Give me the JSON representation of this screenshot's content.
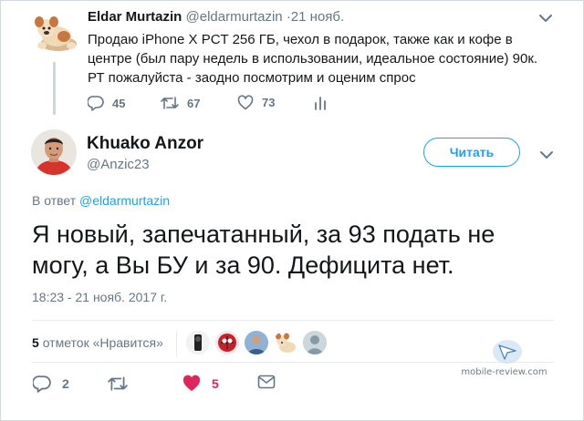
{
  "parent_tweet": {
    "name": "Eldar Murtazin",
    "handle": "@eldarmurtazin",
    "time": "·21 нояб.",
    "text": "Продаю iPhone X PCT 256 ГБ, чехол в подарок, также как и кофе в центре (был пару недель в использовании, идеальное состояние) 90к. РТ пожалуйста - заодно посмотрим и оценим спрос",
    "replies": "45",
    "retweets": "67",
    "likes": "73"
  },
  "main_tweet": {
    "name": "Khuako Anzor",
    "handle": "@Anzic23",
    "follow_label": "Читать",
    "reply_prefix": "В ответ",
    "reply_to": "@eldarmurtazin",
    "text": "Я новый, запечатанный, за 93 подать не могу, а Вы БУ и за 90. Дефицита нет.",
    "date": "18:23 - 21 нояб. 2017 г.",
    "likes_count": "5",
    "likes_label": "отметок «Нравится»",
    "replies": "2",
    "like_count": "5"
  },
  "watermark": {
    "text": "mobile-review.com"
  },
  "colors": {
    "accent": "#1da1f2",
    "muted": "#657786",
    "like": "#e0245e"
  }
}
